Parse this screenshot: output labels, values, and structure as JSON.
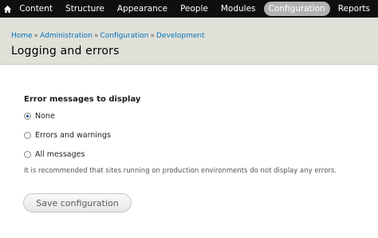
{
  "toolbar": {
    "home_icon": "home-icon",
    "items": [
      {
        "label": "Content"
      },
      {
        "label": "Structure"
      },
      {
        "label": "Appearance"
      },
      {
        "label": "People"
      },
      {
        "label": "Modules"
      },
      {
        "label": "Configuration",
        "active": true
      },
      {
        "label": "Reports"
      }
    ]
  },
  "breadcrumb": {
    "items": [
      "Home",
      "Administration",
      "Configuration",
      "Development"
    ],
    "separator": "»"
  },
  "page": {
    "title": "Logging and errors"
  },
  "form": {
    "fieldset_title": "Error messages to display",
    "options": [
      {
        "label": "None",
        "checked": true
      },
      {
        "label": "Errors and warnings",
        "checked": false
      },
      {
        "label": "All messages",
        "checked": false
      }
    ],
    "description": "It is recommended that sites running on production environments do not display any errors.",
    "save_label": "Save configuration"
  },
  "colors": {
    "toolbar_bg": "#0f0f0f",
    "header_bg": "#e0e0d8",
    "link": "#0074bd",
    "active_tab": "#b2b2b2"
  }
}
